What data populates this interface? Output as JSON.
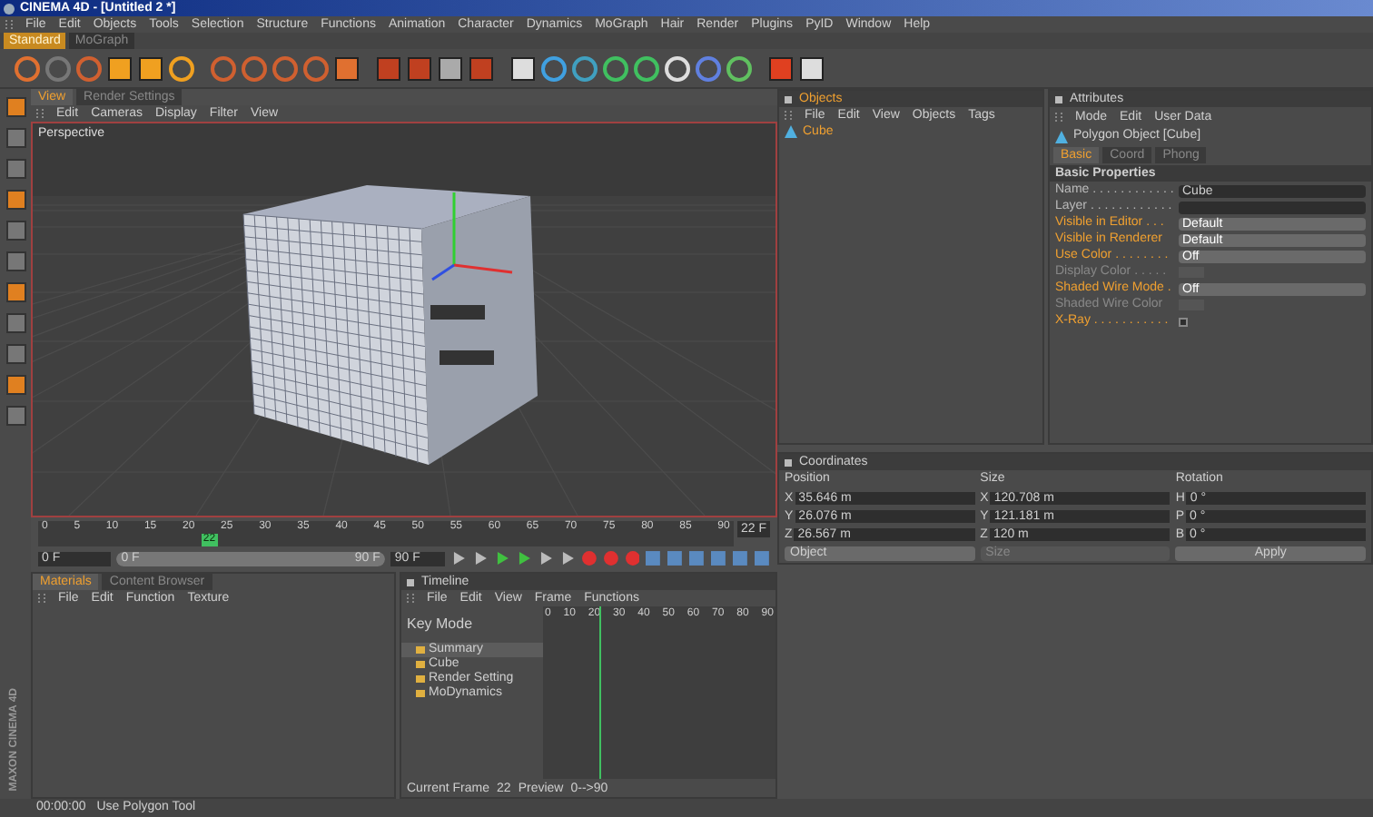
{
  "window": {
    "title": "CINEMA 4D - [Untitled 2 *]"
  },
  "menu": [
    "File",
    "Edit",
    "Objects",
    "Tools",
    "Selection",
    "Structure",
    "Functions",
    "Animation",
    "Character",
    "Dynamics",
    "MoGraph",
    "Hair",
    "Render",
    "Plugins",
    "PyID",
    "Window",
    "Help"
  ],
  "layouts": [
    {
      "label": "Standard",
      "selected": true
    },
    {
      "label": "MoGraph",
      "selected": false
    }
  ],
  "viewport": {
    "tabs": [
      {
        "label": "View",
        "selected": true
      },
      {
        "label": "Render Settings",
        "selected": false
      }
    ],
    "menu": [
      "Edit",
      "Cameras",
      "Display",
      "Filter",
      "View"
    ],
    "camera": "Perspective"
  },
  "ruler": {
    "ticks": [
      "0",
      "5",
      "10",
      "15",
      "20",
      "25",
      "30",
      "35",
      "40",
      "45",
      "50",
      "55",
      "60",
      "65",
      "70",
      "75",
      "80",
      "85",
      "90"
    ],
    "current": "22",
    "frame": "22 F"
  },
  "transport": {
    "start": "0 F",
    "slider_start": "0 F",
    "slider_end": "90 F",
    "end": "90 F",
    "level": 1
  },
  "materials": {
    "tabs": [
      {
        "label": "Materials",
        "selected": true
      },
      {
        "label": "Content Browser",
        "selected": false
      }
    ],
    "menu": [
      "File",
      "Edit",
      "Function",
      "Texture"
    ]
  },
  "timeline": {
    "title": "Timeline",
    "menu": [
      "File",
      "Edit",
      "View",
      "Frame",
      "Functions"
    ],
    "mode": "Key Mode",
    "ticks": [
      "0",
      "10",
      "20",
      "30",
      "40",
      "50",
      "60",
      "70",
      "80",
      "90"
    ],
    "tracks": [
      {
        "name": "Summary",
        "selected": true
      },
      {
        "name": "Cube",
        "selected": false
      },
      {
        "name": "Render Setting",
        "selected": false
      },
      {
        "name": "MoDynamics",
        "selected": false
      }
    ],
    "footer": [
      "Current Frame",
      "22",
      "Preview",
      "0-->90"
    ]
  },
  "objects": {
    "title": "Objects",
    "menu": [
      "File",
      "Edit",
      "View",
      "Objects",
      "Tags"
    ],
    "items": [
      {
        "name": "Cube",
        "selected": true
      }
    ]
  },
  "attributes": {
    "title": "Attributes",
    "menu": [
      "Mode",
      "Edit",
      "User Data"
    ],
    "object": "Polygon Object [Cube]",
    "tabs": [
      {
        "label": "Basic",
        "selected": true
      },
      {
        "label": "Coord",
        "selected": false
      },
      {
        "label": "Phong",
        "selected": false
      }
    ],
    "section": "Basic Properties",
    "rows": [
      {
        "label": "Name . . . . . . . . . . . .",
        "kind": "field",
        "value": "Cube",
        "disabled": false,
        "animatable": false
      },
      {
        "label": "Layer . . . . . . . . . . . .",
        "kind": "field",
        "disabled": false,
        "animatable": false
      },
      {
        "label": "Visible in Editor . . .",
        "kind": "dropdown",
        "value": "Default",
        "disabled": false,
        "animatable": true
      },
      {
        "label": "Visible in Renderer",
        "kind": "dropdown",
        "value": "Default",
        "disabled": false,
        "animatable": true
      },
      {
        "label": "Use Color . . . . . . . .",
        "kind": "dropdown",
        "value": "Off",
        "disabled": false,
        "animatable": true
      },
      {
        "label": "Display Color . . . . .",
        "kind": "color",
        "disabled": true,
        "animatable": false
      },
      {
        "label": "Shaded Wire Mode .",
        "kind": "dropdown",
        "value": "Off",
        "disabled": false,
        "animatable": true
      },
      {
        "label": "Shaded Wire Color",
        "kind": "color",
        "disabled": true,
        "animatable": false
      },
      {
        "label": "X-Ray . . . . . . . . . . .",
        "kind": "checkbox",
        "checked": false,
        "disabled": false,
        "animatable": true
      }
    ]
  },
  "coordinates": {
    "title": "Coordinates",
    "columns": [
      "Position",
      "Size",
      "Rotation"
    ],
    "rows": [
      [
        {
          "axis": "X",
          "value": "35.646 m"
        },
        {
          "axis": "X",
          "value": "120.708 m"
        },
        {
          "axis": "H",
          "value": "0 °"
        }
      ],
      [
        {
          "axis": "Y",
          "value": "26.076 m"
        },
        {
          "axis": "Y",
          "value": "121.181 m"
        },
        {
          "axis": "P",
          "value": "0 °"
        }
      ],
      [
        {
          "axis": "Z",
          "value": "26.567 m"
        },
        {
          "axis": "Z",
          "value": "120 m"
        },
        {
          "axis": "B",
          "value": "0 °"
        }
      ]
    ],
    "mode": "Object",
    "size_mode": "Size",
    "apply": "Apply"
  },
  "brand": "MAXON CINEMA 4D",
  "status": {
    "time": "00:00:00",
    "message": "Use Polygon Tool"
  }
}
